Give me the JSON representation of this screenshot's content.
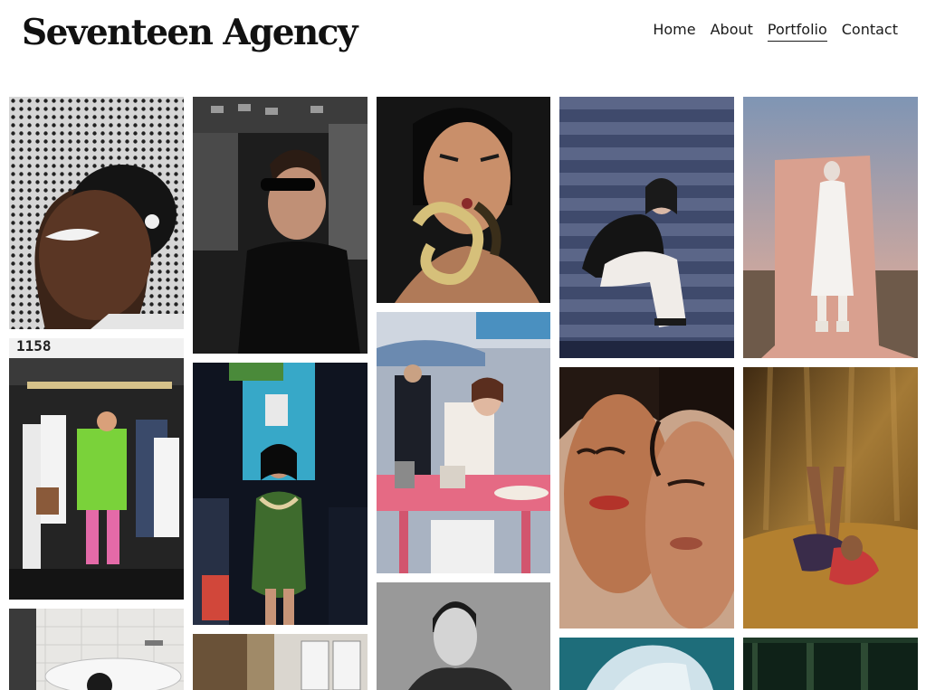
{
  "site": {
    "title": "Seventeen Agency"
  },
  "nav": {
    "items": [
      "Home",
      "About",
      "Portfolio",
      "Contact"
    ],
    "active": "Portfolio"
  },
  "gallery": {
    "photos": [
      {
        "column": 1,
        "subject": "model with white eye makeup behind mesh",
        "palette": [
          "#cfcfcf",
          "#4a2e22"
        ]
      },
      {
        "column": 1,
        "subject": "model in green suit on subway train",
        "palette": [
          "#2b2b2b",
          "#7ad23a"
        ],
        "sign_text": "1158"
      },
      {
        "column": 1,
        "subject": "bathroom with bathtub",
        "palette": [
          "#e9e9e7",
          "#cfcfcc"
        ]
      },
      {
        "column": 2,
        "subject": "man in sunglasses and dark coat",
        "palette": [
          "#1c1c1c",
          "#3a3a3a"
        ]
      },
      {
        "column": 2,
        "subject": "woman in green dress with snake",
        "palette": [
          "#101826",
          "#3e6d2e"
        ]
      },
      {
        "column": 2,
        "subject": "window with wooden frame",
        "palette": [
          "#d8d4ce",
          "#8a6a42"
        ]
      },
      {
        "column": 3,
        "subject": "woman holding snake close-up",
        "palette": [
          "#141414",
          "#c98f6a"
        ]
      },
      {
        "column": 3,
        "subject": "woman at pink table in street market",
        "palette": [
          "#9aa7b8",
          "#e56a84"
        ]
      },
      {
        "column": 3,
        "subject": "black and white portrait of man",
        "palette": [
          "#9a9a9a",
          "#2a2a2a"
        ]
      },
      {
        "column": 4,
        "subject": "woman sitting on stadium steps",
        "palette": [
          "#3f4a6c",
          "#1c2238"
        ]
      },
      {
        "column": 4,
        "subject": "two women faces close-up",
        "palette": [
          "#c58a67",
          "#3a1c12"
        ]
      },
      {
        "column": 4,
        "subject": "person in pale blue headscarf",
        "palette": [
          "#1e6d7a",
          "#cfe2ea"
        ]
      },
      {
        "column": 5,
        "subject": "model in white coat on pink backdrop",
        "palette": [
          "#8fa1b8",
          "#d9a08f"
        ]
      },
      {
        "column": 5,
        "subject": "woman lying on amber fabric",
        "palette": [
          "#5a3b16",
          "#b98a3a"
        ]
      },
      {
        "column": 5,
        "subject": "dark green doorway",
        "palette": [
          "#0f2218",
          "#2d4a33"
        ]
      }
    ]
  }
}
